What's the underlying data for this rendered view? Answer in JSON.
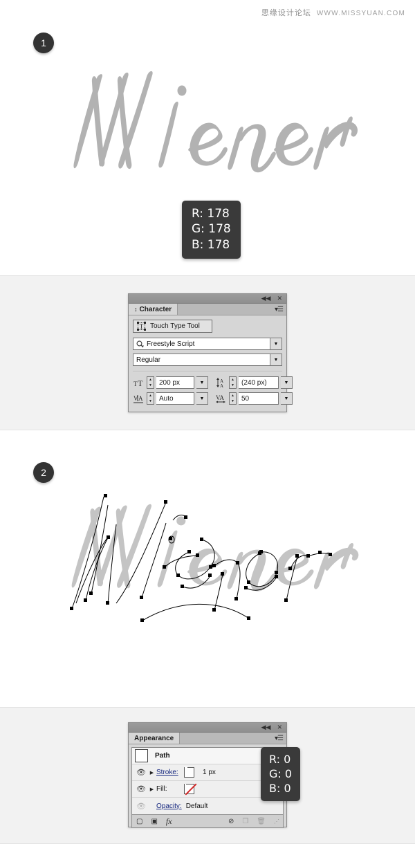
{
  "watermark": {
    "cn": "思缘设计论坛",
    "url": "WWW.MISSYUAN.COM"
  },
  "steps": [
    {
      "number": "1",
      "artwork_text": "Wiener"
    },
    {
      "number": "2",
      "artwork_text": "Wiener"
    }
  ],
  "tooltips": [
    {
      "name": "text-color-readout",
      "r": "R: 178",
      "g": "G: 178",
      "b": "B: 178",
      "hex": "#b2b2b2"
    },
    {
      "name": "stroke-color-readout",
      "r": "R: 0",
      "g": "G: 0",
      "b": "B: 0",
      "hex": "#000000"
    }
  ],
  "character_panel": {
    "tab_label": "Character",
    "collapse_icon": "◀◀",
    "close_icon": "✕",
    "menu_icon": "▾☰",
    "touch_type_tool": "Touch Type Tool",
    "font_family": "Freestyle Script",
    "font_style": "Regular",
    "font_size": "200 px",
    "leading": "(240 px)",
    "kerning": "Auto",
    "tracking": "50",
    "dropdown_caret": "▼",
    "search_icon": "search-icon",
    "icons": {
      "font_size": "TT",
      "leading": "A/A",
      "kerning": "V/A",
      "tracking": "VA"
    }
  },
  "appearance_panel": {
    "tab_label": "Appearance",
    "collapse_icon": "◀◀",
    "close_icon": "✕",
    "menu_icon": "▾☰",
    "rows": [
      {
        "name": "path",
        "label": "Path",
        "type": "header"
      },
      {
        "name": "stroke",
        "label": "Stroke:",
        "value": "1 px",
        "swatch": "black",
        "eye": "visible"
      },
      {
        "name": "fill",
        "label": "Fill:",
        "value": "",
        "swatch": "none",
        "eye": "visible"
      },
      {
        "name": "opacity",
        "label": "Opacity:",
        "value": "Default",
        "swatch": "",
        "eye": "dim"
      }
    ],
    "footer": {
      "add_stroke": "▢",
      "add_fill": "▣",
      "fx": "fx",
      "clear": "⊘",
      "duplicate": "❐",
      "delete": "🗑",
      "grip": "⋰"
    }
  },
  "colors": {
    "script_grey": "#b2b2b2",
    "badge_bg": "#333333",
    "section_grey": "#f2f2f2",
    "panel_bg": "#d6d6d6",
    "link_blue": "#14267e"
  }
}
